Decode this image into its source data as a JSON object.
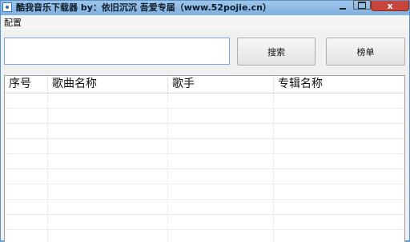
{
  "window": {
    "title": "酷我音乐下载器 by：依旧沉沉 吾爱专届（www.52pojie.cn）",
    "controls": {
      "close_glyph": "x"
    }
  },
  "menu": {
    "items": [
      "配置"
    ]
  },
  "search": {
    "value": "",
    "placeholder": "",
    "search_button": "搜索",
    "chart_button": "榜单"
  },
  "table": {
    "columns": [
      "序号",
      "歌曲名称",
      "歌手",
      "专辑名称"
    ],
    "rows": []
  },
  "colors": {
    "titlebar": "#8db9e6",
    "close_button": "#c9453b",
    "input_border": "#7aa7d4"
  }
}
